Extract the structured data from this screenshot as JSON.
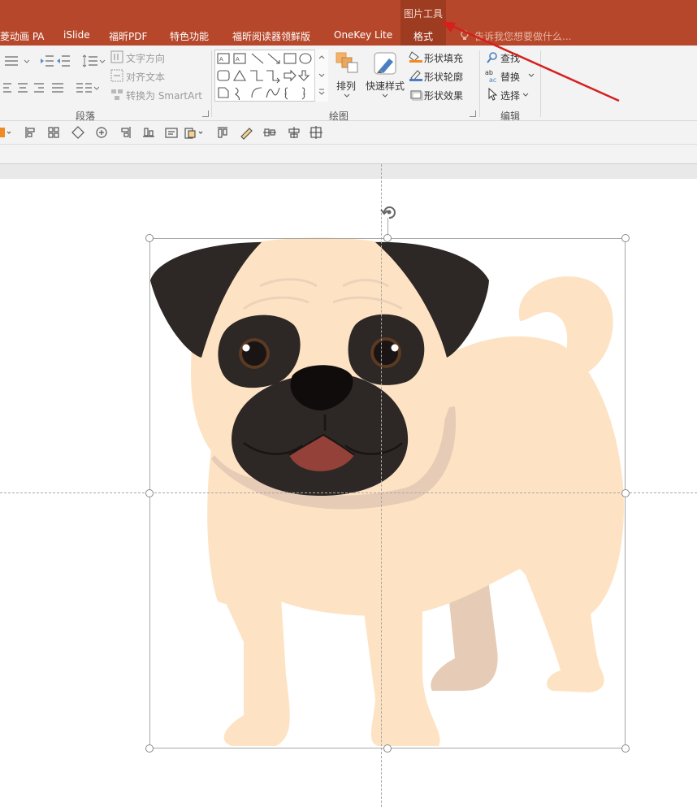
{
  "titlebar": {
    "context_tool_label": "图片工具",
    "tabs": [
      {
        "label": "菱动画 PA"
      },
      {
        "label": "iSlide"
      },
      {
        "label": "福昕PDF"
      },
      {
        "label": "特色功能"
      },
      {
        "label": "福昕阅读器领鲜版"
      },
      {
        "label": "OneKey Lite"
      },
      {
        "label": "格式"
      }
    ],
    "tell_me": "告诉我您想要做什么..."
  },
  "ribbon": {
    "paragraph": {
      "text_direction": "文字方向",
      "align_text": "对齐文本",
      "convert_smartart": "转换为 SmartArt",
      "group_label": "段落"
    },
    "drawing": {
      "arrange": "排列",
      "quick_styles": "快速样式",
      "shape_fill": "形状填充",
      "shape_outline": "形状轮廓",
      "shape_effects": "形状效果",
      "group_label": "绘图"
    },
    "editing": {
      "find": "查找",
      "replace": "替换",
      "select": "选择",
      "group_label": "编辑"
    }
  },
  "colors": {
    "titlebar": "#b7472a",
    "context_tab": "#9e3c22",
    "ribbon": "#f3f3f3",
    "annotation_arrow": "#d61f1f",
    "dog_body": "#fde3c3",
    "dog_dark": "#2d2725",
    "dog_shadow": "#e6cbb6",
    "dog_tongue": "#934139"
  }
}
